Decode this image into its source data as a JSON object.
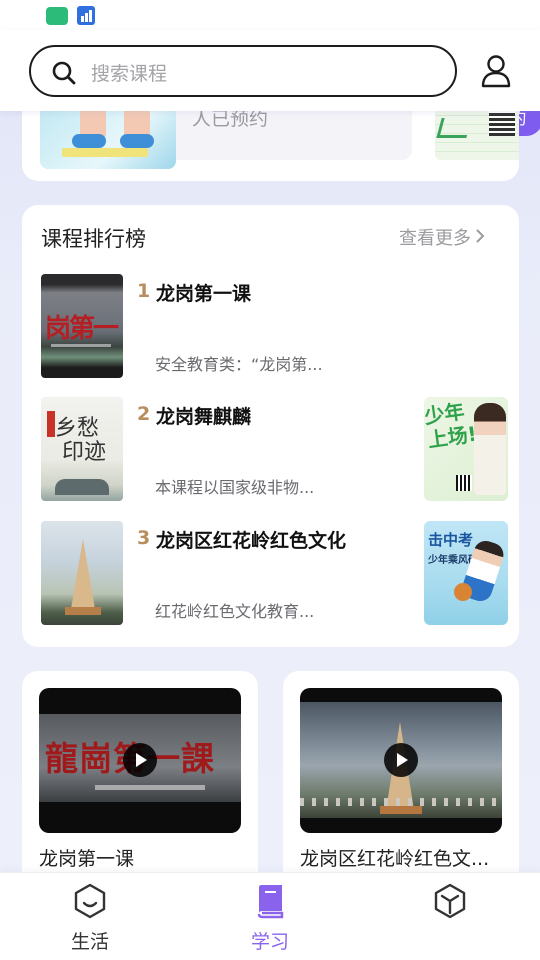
{
  "colors": {
    "accent": "#7e5cf0",
    "rank_number": "#b98e5e",
    "tab_active": "#8a63ec"
  },
  "search": {
    "placeholder": "搜索课程"
  },
  "icons": {
    "search": "search-icon",
    "user": "user-icon",
    "chevron": "chevron-right-icon",
    "play": "play-icon"
  },
  "promo": {
    "count_text": "人已预约",
    "book_label": "预约"
  },
  "ranking": {
    "title": "课程排行榜",
    "more_label": "查看更多",
    "items": [
      {
        "rank": "1",
        "name": "龙岗第一课",
        "desc": "安全教育类：“龙岗第..."
      },
      {
        "rank": "2",
        "name": "龙岗舞麒麟",
        "desc": "本课程以国家级非物..."
      },
      {
        "rank": "3",
        "name": "龙岗区红花岭红色文化",
        "desc": "红花岭红色文化教育..."
      }
    ]
  },
  "videos": [
    {
      "title": "龙岗第一课"
    },
    {
      "title": "龙岗区红花岭红色文..."
    }
  ],
  "tabs": [
    {
      "label": "生活",
      "icon": "life-icon",
      "active": false
    },
    {
      "label": "学习",
      "icon": "book-icon",
      "active": true
    },
    {
      "label": "",
      "icon": "cube-icon",
      "active": false
    }
  ]
}
